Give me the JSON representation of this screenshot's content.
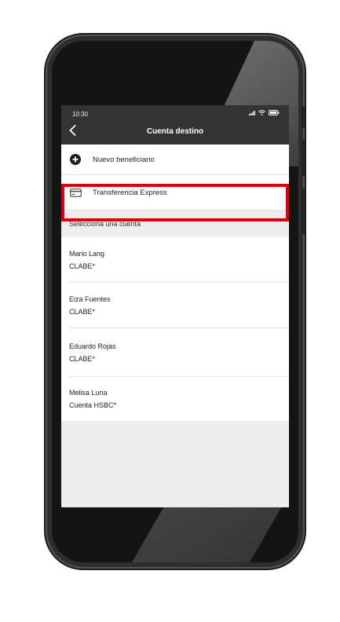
{
  "status_bar": {
    "time": "10:30"
  },
  "header": {
    "title": "Cuenta destino"
  },
  "actions": [
    {
      "label": "Nuevo beneficiario",
      "icon": "add-circle-icon"
    },
    {
      "label": "Transferencia Express",
      "icon": "card-icon"
    }
  ],
  "section": {
    "title": "Selecciona una cuenta"
  },
  "accounts": [
    {
      "name": "Mario Lang",
      "type": "CLABE*"
    },
    {
      "name": "Eiza Fuentes",
      "type": "CLABE*"
    },
    {
      "name": "Eduardo Rojas",
      "type": "CLABE*"
    },
    {
      "name": "Melisa Luna",
      "type": "Cuenta HSBC*"
    }
  ],
  "colors": {
    "header_bg": "#333333",
    "highlight": "#db0011",
    "screen_bg": "#ededed"
  }
}
